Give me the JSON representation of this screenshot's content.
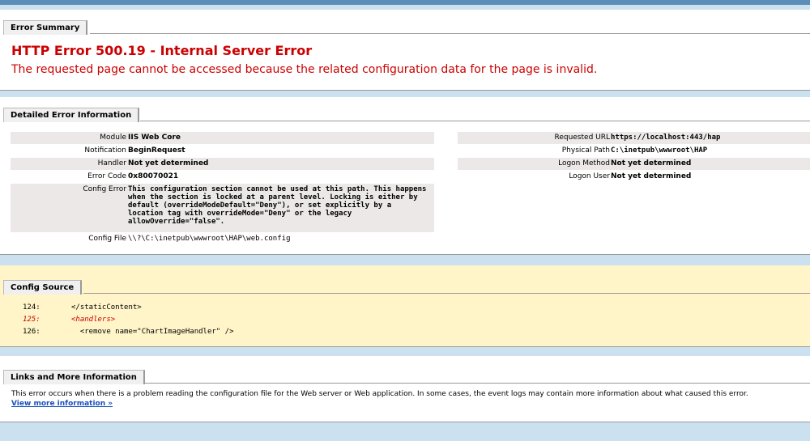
{
  "error_summary": {
    "header": "Error Summary",
    "title": "HTTP Error 500.19 - Internal Server Error",
    "message": "The requested page cannot be accessed because the related configuration data for the page is invalid."
  },
  "detailed": {
    "header": "Detailed Error Information",
    "module_label": "Module",
    "module_value": "IIS Web Core",
    "notification_label": "Notification",
    "notification_value": "BeginRequest",
    "handler_label": "Handler",
    "handler_value": "Not yet determined",
    "error_code_label": "Error Code",
    "error_code_value": "0x80070021",
    "config_error_label": "Config Error",
    "config_error_value": "This configuration section cannot be used at this path. This happens when the section is locked at a parent level. Locking is either by default (overrideModeDefault=\"Deny\"), or set explicitly by a location tag with overrideMode=\"Deny\" or the legacy allowOverride=\"false\".",
    "config_file_label": "Config File",
    "config_file_value": "\\\\?\\C:\\inetpub\\wwwroot\\HAP\\web.config",
    "requested_url_label": "Requested URL",
    "requested_url_value": "https://localhost:443/hap",
    "physical_path_label": "Physical Path",
    "physical_path_value": "C:\\inetpub\\wwwroot\\HAP",
    "logon_method_label": "Logon Method",
    "logon_method_value": "Not yet determined",
    "logon_user_label": "Logon User",
    "logon_user_value": "Not yet determined"
  },
  "config_source": {
    "header": "Config Source",
    "lines": [
      {
        "num": "124:",
        "code": "</staticContent>"
      },
      {
        "num": "125:",
        "code": "<handlers>"
      },
      {
        "num": "126:",
        "code": "  <remove name=\"ChartImageHandler\" />"
      }
    ]
  },
  "links": {
    "header": "Links and More Information",
    "text": "This error occurs when there is a problem reading the configuration file for the Web server or Web application. In some cases, the event logs may contain more information about what caused this error.",
    "link_label": "View more information »"
  },
  "colors": {
    "error_red": "#cc0000",
    "config_source_bg": "#fff5c9",
    "link_blue": "#1a4fbf",
    "page_bg": "#cbe1ef"
  }
}
